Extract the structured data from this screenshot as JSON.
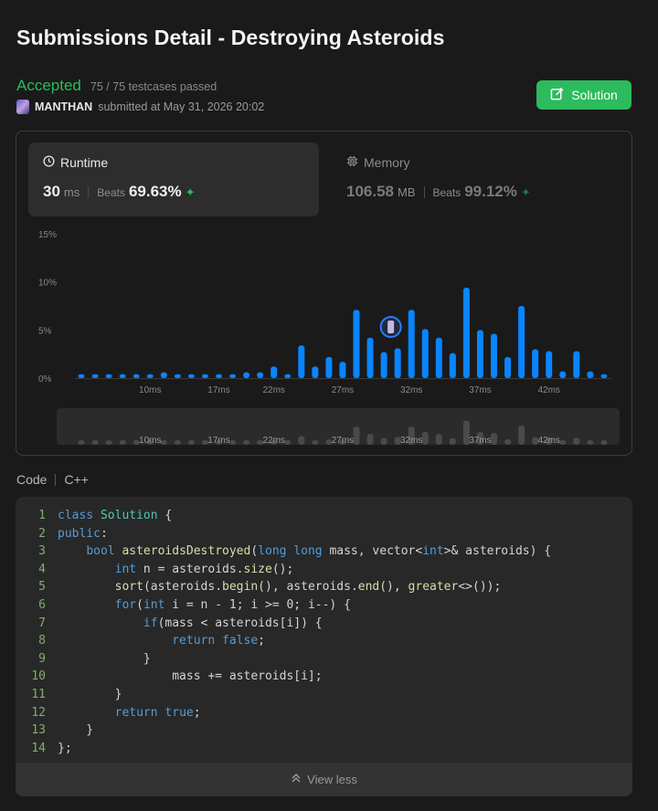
{
  "page": {
    "title": "Submissions Detail - Destroying Asteroids"
  },
  "status": {
    "verdict": "Accepted",
    "testcases": "75 / 75 testcases passed",
    "username": "MANTHAN",
    "submitted_text": "submitted at May 31, 2026 20:02"
  },
  "solution_button": {
    "label": "Solution"
  },
  "runtime": {
    "label": "Runtime",
    "value": "30",
    "unit": "ms",
    "beats_label": "Beats",
    "beats_pct": "69.63%"
  },
  "memory": {
    "label": "Memory",
    "value": "106.58",
    "unit": "MB",
    "beats_label": "Beats",
    "beats_pct": "99.12%"
  },
  "chart_data": {
    "type": "bar",
    "xlabel": "",
    "ylabel": "",
    "ylim": [
      0,
      15
    ],
    "y_ticks": [
      "15%",
      "10%",
      "5%",
      "0%"
    ],
    "x_ticks": [
      "10ms",
      "17ms",
      "22ms",
      "27ms",
      "32ms",
      "37ms",
      "42ms"
    ],
    "values": [
      0.4,
      0.4,
      0.4,
      0.4,
      0.4,
      0.4,
      0.6,
      0.4,
      0.4,
      0.4,
      0.4,
      0.4,
      0.6,
      0.6,
      1.2,
      0.4,
      3.4,
      1.2,
      2.2,
      1.7,
      7.1,
      4.2,
      2.7,
      3.1,
      7.1,
      5.1,
      4.2,
      2.6,
      9.4,
      5.0,
      4.6,
      2.2,
      7.5,
      3.0,
      2.8,
      0.7,
      2.8,
      0.7,
      0.4
    ],
    "highlight_index": 23,
    "bar_color": "#0a84ff",
    "navigator_ticks": [
      "10ms",
      "17ms",
      "22ms",
      "27ms",
      "32ms",
      "37ms",
      "42ms"
    ]
  },
  "code_section": {
    "label": "Code",
    "language": "C++"
  },
  "code_lines": [
    "class Solution {",
    "public:",
    "    bool asteroidsDestroyed(long long mass, vector<int>& asteroids) {",
    "        int n = asteroids.size();",
    "        sort(asteroids.begin(), asteroids.end(), greater<>());",
    "        for(int i = n - 1; i >= 0; i--) {",
    "            if(mass < asteroids[i]) {",
    "                return false;",
    "            }",
    "                mass += asteroids[i];",
    "        }",
    "        return true;",
    "    }",
    "};"
  ],
  "line_numbers": [
    "1",
    "2",
    "3",
    "4",
    "5",
    "6",
    "7",
    "8",
    "9",
    "10",
    "11",
    "12",
    "13",
    "14"
  ],
  "view_less": {
    "label": "View less"
  },
  "colors": {
    "accent_green": "#2cbb5d",
    "bar_blue": "#0a84ff",
    "background": "#1a1a1a"
  }
}
